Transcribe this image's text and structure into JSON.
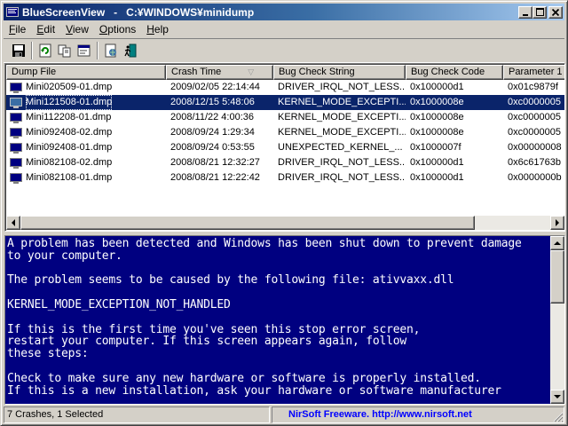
{
  "window": {
    "title": "BlueScreenView   -   C:¥WINDOWS¥minidump",
    "caption_buttons": {
      "minimize": "_",
      "maximize": "□",
      "close": "✕"
    }
  },
  "menu": [
    {
      "label": "File",
      "key": "F",
      "rest": "ile"
    },
    {
      "label": "Edit",
      "key": "E",
      "rest": "dit"
    },
    {
      "label": "View",
      "key": "V",
      "rest": "iew"
    },
    {
      "label": "Options",
      "key": "O",
      "rest": "ptions"
    },
    {
      "label": "Help",
      "key": "H",
      "rest": "elp"
    }
  ],
  "toolbar": {
    "icons": [
      "save-icon",
      "refresh-icon",
      "copy-icon",
      "properties-icon",
      "html-report-icon",
      "exit-icon"
    ]
  },
  "list": {
    "columns": [
      "Dump File",
      "Crash Time",
      "Bug Check String",
      "Bug Check Code",
      "Parameter 1"
    ],
    "sort_indicator": "▽",
    "rows": [
      {
        "file": "Mini020509-01.dmp",
        "time": "2009/02/05 22:14:44",
        "string": "DRIVER_IRQL_NOT_LESS...",
        "code": "0x100000d1",
        "param1": "0x01c9879f"
      },
      {
        "file": "Mini121508-01.dmp",
        "time": "2008/12/15 5:48:06",
        "string": "KERNEL_MODE_EXCEPTI...",
        "code": "0x1000008e",
        "param1": "0xc0000005"
      },
      {
        "file": "Mini112208-01.dmp",
        "time": "2008/11/22 4:00:36",
        "string": "KERNEL_MODE_EXCEPTI...",
        "code": "0x1000008e",
        "param1": "0xc0000005"
      },
      {
        "file": "Mini092408-02.dmp",
        "time": "2008/09/24 1:29:34",
        "string": "KERNEL_MODE_EXCEPTI...",
        "code": "0x1000008e",
        "param1": "0xc0000005"
      },
      {
        "file": "Mini092408-01.dmp",
        "time": "2008/09/24 0:53:55",
        "string": "UNEXPECTED_KERNEL_...",
        "code": "0x1000007f",
        "param1": "0x00000008"
      },
      {
        "file": "Mini082108-02.dmp",
        "time": "2008/08/21 12:32:27",
        "string": "DRIVER_IRQL_NOT_LESS...",
        "code": "0x100000d1",
        "param1": "0x6c61763b"
      },
      {
        "file": "Mini082108-01.dmp",
        "time": "2008/08/21 12:22:42",
        "string": "DRIVER_IRQL_NOT_LESS...",
        "code": "0x100000d1",
        "param1": "0x0000000b"
      }
    ],
    "selected_row": 1
  },
  "bsod": {
    "lines": [
      "A problem has been detected and Windows has been shut down to prevent damage",
      "to your computer.",
      "",
      "The problem seems to be caused by the following file: ativvaxx.dll",
      "",
      "KERNEL_MODE_EXCEPTION_NOT_HANDLED",
      "",
      "If this is the first time you've seen this stop error screen,",
      "restart your computer. If this screen appears again, follow",
      "these steps:",
      "",
      "Check to make sure any new hardware or software is properly installed.",
      "If this is a new installation, ask your hardware or software manufacturer"
    ],
    "colors": {
      "background": "#000080",
      "text": "#ffffff"
    }
  },
  "status": {
    "left": "7 Crashes, 1 Selected",
    "right": "NirSoft Freeware.  http://www.nirsoft.net"
  },
  "colors": {
    "title_start": "#0a246a",
    "title_end": "#a6caf0",
    "selection": "#0a246a",
    "face": "#d4d0c8",
    "link": "#0000ff"
  }
}
